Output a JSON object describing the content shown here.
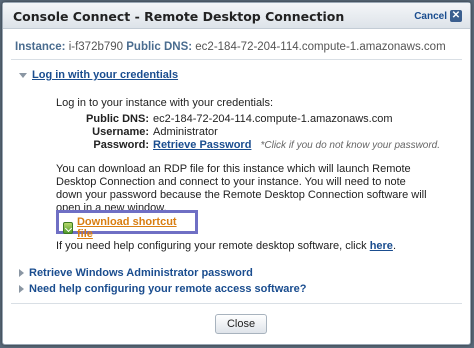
{
  "dialog": {
    "title": "Console Connect - Remote Desktop Connection",
    "cancel_label": "Cancel",
    "close_glyph": "✕"
  },
  "instance": {
    "instance_label": "Instance:",
    "instance_value": "i-f372b790",
    "dns_label": "Public DNS:",
    "dns_value": "ec2-184-72-204-114.compute-1.amazonaws.com"
  },
  "credentials_section": {
    "heading": "Log in with your credentials",
    "intro": "Log in to your instance with your credentials:",
    "public_dns_label": "Public DNS:",
    "public_dns_value": "ec2-184-72-204-114.compute-1.amazonaws.com",
    "username_label": "Username:",
    "username_value": "Administrator",
    "password_label": "Password:",
    "password_link": "Retrieve Password",
    "password_hint": "*Click if you do not know your password.",
    "rdp_text_1": "You can download an RDP file for this instance which will launch Remote",
    "rdp_text_2": "Desktop Connection and connect to your instance. You will need to note",
    "rdp_text_3": "down your password because the Remote Desktop Connection software will",
    "rdp_text_4": "open in a new window.",
    "download_label": "Download shortcut file",
    "help_prefix": "If you need help configuring your remote desktop software, click",
    "help_link": "here",
    "help_suffix": "."
  },
  "collapsed_sections": [
    {
      "label": "Retrieve Windows Administrator password"
    },
    {
      "label": "Need help configuring your remote access software?"
    }
  ],
  "footer": {
    "close_label": "Close"
  },
  "colors": {
    "link": "#1a4d8f",
    "download_link": "#d97e11",
    "highlight_border": "#6f6fc4"
  }
}
